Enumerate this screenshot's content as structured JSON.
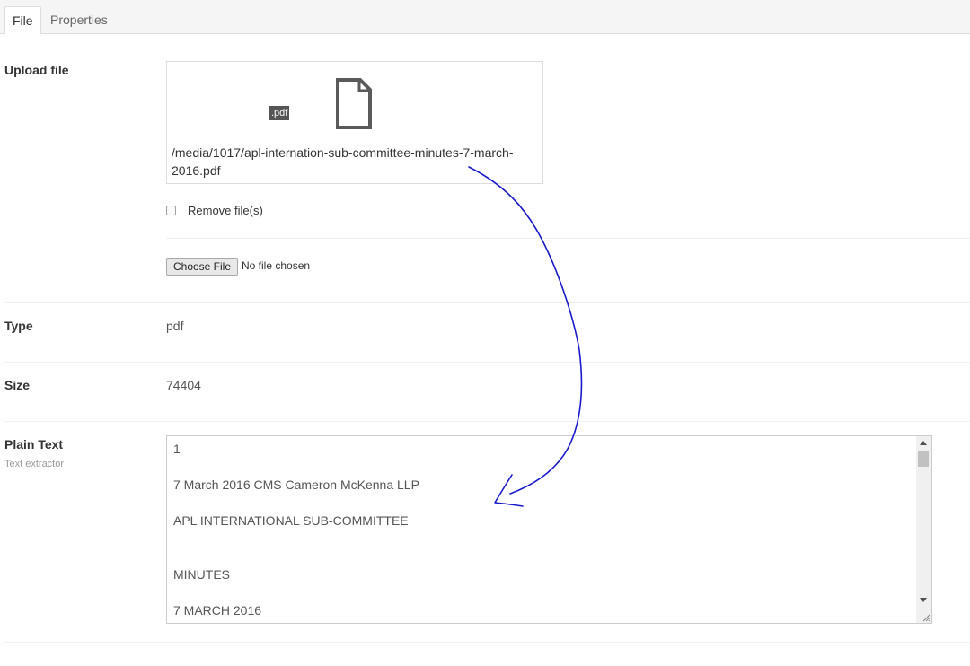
{
  "tabs": [
    {
      "label": "File",
      "active": true
    },
    {
      "label": "Properties",
      "active": false
    }
  ],
  "upload": {
    "label": "Upload file",
    "badge": ".pdf",
    "file_path": "/media/1017/apl-internation-sub-committee-minutes-7-march-2016.pdf",
    "remove_label": "Remove file(s)",
    "choose_button": "Choose File",
    "no_file_text": "No file chosen",
    "remove_checked": false
  },
  "type": {
    "label": "Type",
    "value": "pdf"
  },
  "size": {
    "label": "Size",
    "value": "74404"
  },
  "plain_text": {
    "label": "Plain Text",
    "sublabel": "Text extractor",
    "lines": [
      "1",
      "7 March 2016 CMS Cameron McKenna LLP",
      "APL INTERNATIONAL SUB-COMMITTEE",
      "MINUTES",
      "7 MARCH 2016"
    ]
  },
  "colors": {
    "annotation_arrow": "#1a1acd",
    "badge_bg": "#555555"
  },
  "icons": [
    "file-document-icon",
    "arrow-up-icon",
    "arrow-down-icon",
    "resize-grip-icon"
  ]
}
